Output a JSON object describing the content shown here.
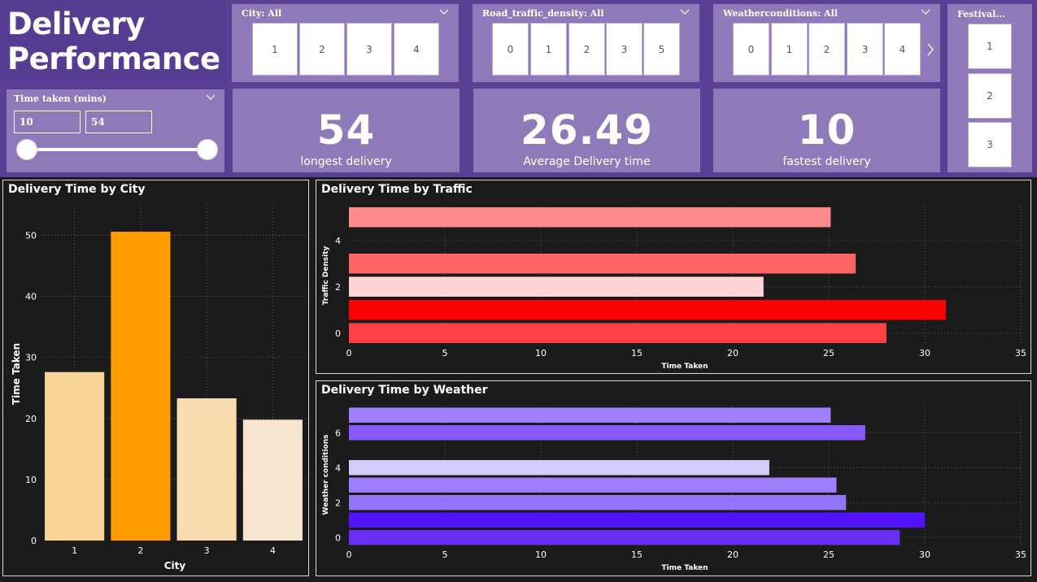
{
  "header": {
    "title": "Delivery\nPerformance"
  },
  "slicers": {
    "city": {
      "title": "City: All",
      "options": [
        "1",
        "2",
        "3",
        "4"
      ]
    },
    "traffic": {
      "title": "Road_traffic_density: All",
      "options": [
        "0",
        "1",
        "2",
        "3",
        "5"
      ]
    },
    "weather": {
      "title": "Weatherconditions: All",
      "options": [
        "0",
        "1",
        "2",
        "3",
        "4"
      ]
    },
    "festival": {
      "title": "Festival...",
      "options": [
        "1",
        "2",
        "3"
      ]
    },
    "time_taken": {
      "title": "Time taken (mins)",
      "min_value": "10",
      "max_value": "54"
    }
  },
  "kpis": {
    "longest": {
      "value": "54",
      "label": "longest delivery"
    },
    "average": {
      "value": "26.49",
      "label": "Average Delivery time"
    },
    "fastest": {
      "value": "10",
      "label": "fastest delivery"
    }
  },
  "colors": {
    "header_bg": "#5a3f95",
    "panel_bg": "#8f7ab9",
    "canvas_bg": "#1b1b1b"
  },
  "chart_data": [
    {
      "type": "bar",
      "title": "Delivery Time by City",
      "xlabel": "City",
      "ylabel": "Time Taken",
      "categories": [
        "1",
        "2",
        "3",
        "4"
      ],
      "values": [
        27.6,
        50.6,
        23.3,
        19.8
      ],
      "colors": [
        "#fad59a",
        "#ff9d00",
        "#f9dcb0",
        "#f7e7d0"
      ],
      "ylim": [
        0,
        55
      ],
      "yticks": [
        0,
        10,
        20,
        30,
        40,
        50
      ],
      "grid": true
    },
    {
      "type": "bar",
      "orientation": "horizontal",
      "title": "Delivery Time by Traffic",
      "xlabel": "Time Taken",
      "ylabel": "Traffic Density",
      "categories": [
        0,
        1,
        2,
        3,
        5
      ],
      "values": [
        28,
        31.1,
        21.6,
        26.4,
        25.1
      ],
      "colors": [
        "#ff4146",
        "#ff0000",
        "#ffd3d5",
        "#ff6467",
        "#ff8a8b"
      ],
      "xlim": [
        0,
        35
      ],
      "xticks": [
        0,
        5,
        10,
        15,
        20,
        25,
        30,
        35
      ],
      "yticks": [
        0,
        2,
        4
      ],
      "grid": true
    },
    {
      "type": "bar",
      "orientation": "horizontal",
      "title": "Delivery Time by Weather",
      "xlabel": "Time Taken",
      "ylabel": "Weather conditions",
      "categories": [
        0,
        1,
        2,
        3,
        4,
        6,
        7
      ],
      "values": [
        28.7,
        30,
        25.9,
        25.4,
        21.9,
        26.9,
        25.1
      ],
      "colors": [
        "#6a2ff7",
        "#5313ff",
        "#9374fb",
        "#9c7efe",
        "#d6ccfc",
        "#8759fc",
        "#a080fd"
      ],
      "xlim": [
        0,
        35
      ],
      "xticks": [
        0,
        5,
        10,
        15,
        20,
        25,
        30,
        35
      ],
      "yticks": [
        0,
        2,
        4,
        6
      ],
      "grid": true
    }
  ]
}
